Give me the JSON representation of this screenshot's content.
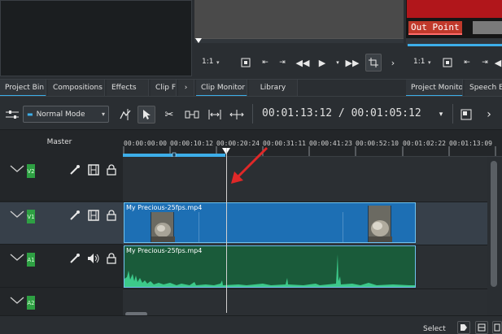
{
  "monitors": {
    "clip_zoom": "1:1",
    "project_zoom": "1:1",
    "out_point_label": "Out Point"
  },
  "tabs": {
    "left": [
      "Project Bin",
      "Compositions",
      "Effects",
      "Clip F"
    ],
    "middle": [
      "Clip Monitor",
      "Library"
    ],
    "right": [
      "Project Monitor",
      "Speech Edi"
    ]
  },
  "toolbar": {
    "mode": "Normal Mode",
    "timecode": "00:01:13:12 / 00:01:05:12"
  },
  "headers": {
    "master_label": "Master",
    "tracks": [
      {
        "tag": "V2",
        "type": "video"
      },
      {
        "tag": "V1",
        "type": "video"
      },
      {
        "tag": "A1",
        "type": "audio"
      },
      {
        "tag": "A2",
        "type": "audio"
      }
    ]
  },
  "ruler": {
    "ticks": [
      "00:00:00:00",
      "00:00:10:12",
      "00:00:20:24",
      "00:00:31:11",
      "00:00:41:23",
      "00:00:52:10",
      "00:01:02:22",
      "00:01:13:09"
    ]
  },
  "clips": {
    "video_clip": "My Precious-25fps.mp4",
    "audio_clip": "My Precious-25fps.mp4"
  },
  "status": {
    "select_label": "Select"
  },
  "colors": {
    "accent": "#3daee9",
    "video_clip": "#1d6fb4",
    "audio_clip": "#1a5b3a",
    "waveform": "#3cc98a",
    "track_tag": "#2ea043",
    "annotation_arrow": "#e02828",
    "out_point": "#c0392b"
  }
}
